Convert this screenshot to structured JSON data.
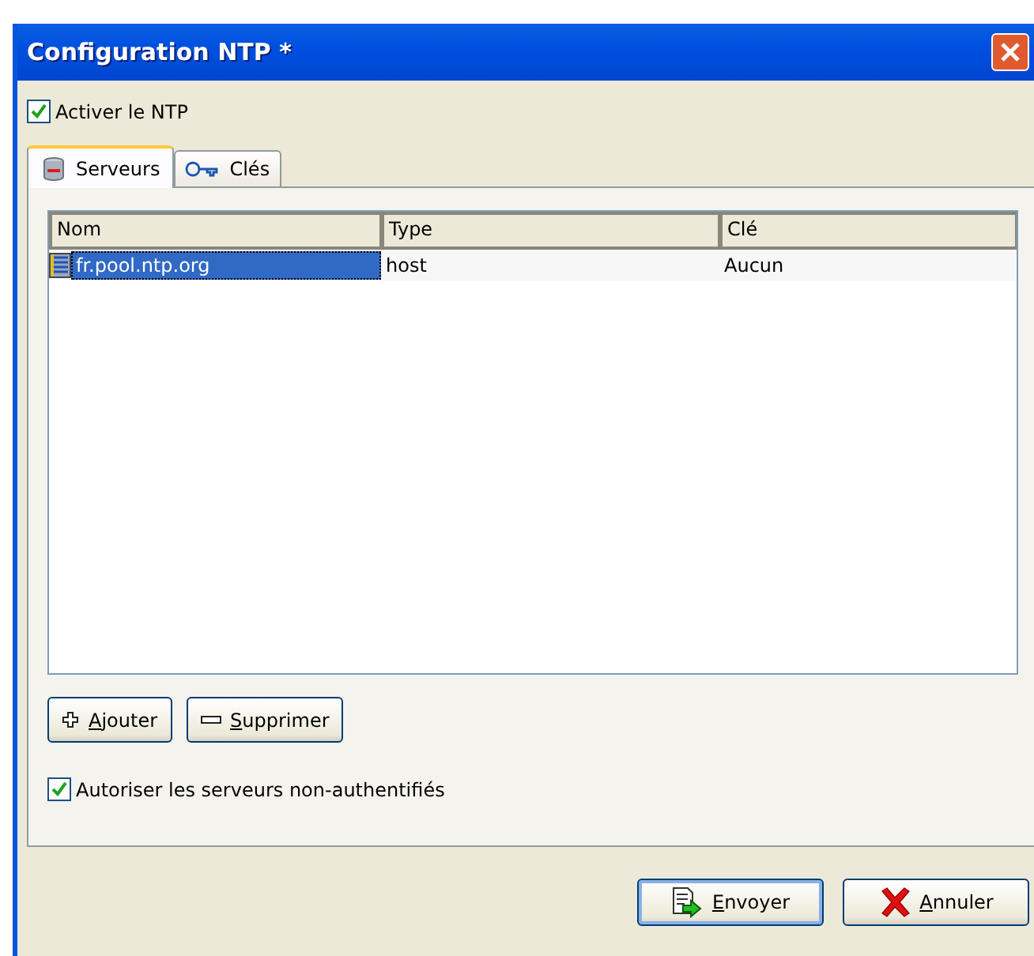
{
  "window": {
    "title": "Configuration NTP *"
  },
  "enable_checkbox": {
    "label": "Activer le NTP",
    "checked": true
  },
  "tabs": [
    {
      "label": "Serveurs",
      "kind": "database",
      "selected": true
    },
    {
      "label": "Clés",
      "kind": "key",
      "selected": false
    }
  ],
  "table": {
    "columns": [
      "Nom",
      "Type",
      "Clé"
    ],
    "rows": [
      {
        "cells": [
          "fr.pool.ntp.org",
          "host",
          "Aucun"
        ],
        "selected": true
      }
    ]
  },
  "list_buttons": [
    {
      "label": "Ajouter",
      "kind": "plus"
    },
    {
      "label": "Supprimer",
      "kind": "minus"
    }
  ],
  "unauth_checkbox": {
    "label": "Autoriser les serveurs non-authentifiés",
    "checked": true
  },
  "dialog_buttons": [
    {
      "label": "Envoyer",
      "kind": "send",
      "default": true
    },
    {
      "label": "Annuler",
      "kind": "cancel",
      "default": false
    }
  ]
}
